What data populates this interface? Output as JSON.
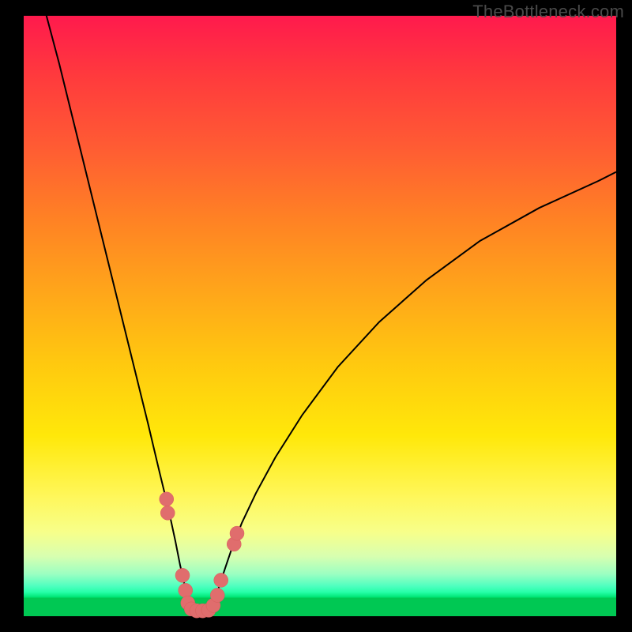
{
  "watermark": "TheBottleneck.com",
  "chart_data": {
    "type": "line",
    "title": "",
    "xlabel": "",
    "ylabel": "",
    "xlim": [
      0,
      1
    ],
    "ylim": [
      0,
      100
    ],
    "left_curve": {
      "x": [
        0.033,
        0.06,
        0.085,
        0.11,
        0.135,
        0.16,
        0.185,
        0.21,
        0.228,
        0.244,
        0.256,
        0.264,
        0.272,
        0.278
      ],
      "y": [
        102,
        92,
        82,
        72,
        62,
        52,
        42,
        32,
        24.5,
        18,
        12.5,
        8.5,
        5.0,
        2.5
      ]
    },
    "right_curve": {
      "x": [
        0.322,
        0.33,
        0.34,
        0.352,
        0.368,
        0.392,
        0.425,
        0.47,
        0.53,
        0.6,
        0.68,
        0.77,
        0.87,
        0.97,
        1.0
      ],
      "y": [
        2.5,
        5.0,
        8.0,
        11.5,
        15.5,
        20.5,
        26.5,
        33.5,
        41.5,
        49.0,
        56.0,
        62.5,
        68.0,
        72.5,
        74.0
      ]
    },
    "floor_segment": {
      "x": [
        0.278,
        0.322
      ],
      "y": [
        1.0,
        1.0
      ]
    },
    "beads": [
      {
        "x": 0.241,
        "y": 19.5,
        "r": 9
      },
      {
        "x": 0.243,
        "y": 17.2,
        "r": 9
      },
      {
        "x": 0.268,
        "y": 6.8,
        "r": 9
      },
      {
        "x": 0.273,
        "y": 4.3,
        "r": 9
      },
      {
        "x": 0.277,
        "y": 2.2,
        "r": 9
      },
      {
        "x": 0.283,
        "y": 1.2,
        "r": 9
      },
      {
        "x": 0.292,
        "y": 0.9,
        "r": 9
      },
      {
        "x": 0.302,
        "y": 0.9,
        "r": 9
      },
      {
        "x": 0.312,
        "y": 1.0,
        "r": 9
      },
      {
        "x": 0.32,
        "y": 1.8,
        "r": 9
      },
      {
        "x": 0.327,
        "y": 3.5,
        "r": 9
      },
      {
        "x": 0.333,
        "y": 6.0,
        "r": 9
      },
      {
        "x": 0.355,
        "y": 12.0,
        "r": 9
      },
      {
        "x": 0.36,
        "y": 13.8,
        "r": 9
      }
    ]
  }
}
